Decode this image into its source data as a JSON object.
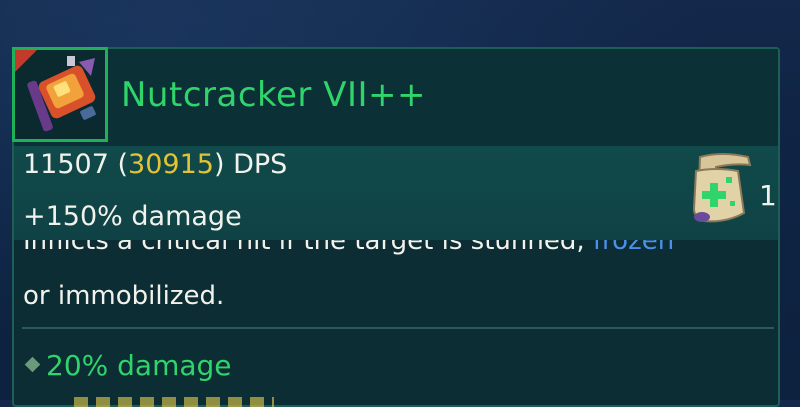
{
  "item": {
    "name": "Nutcracker VII++",
    "icon": "nutcracker-weapon-icon",
    "name_color": "#2fd46a",
    "rarity_border_color": "#1fb05a"
  },
  "stats": {
    "dps_base": "11507",
    "dps_crit": "30915",
    "dps_unit": "DPS",
    "bonus": "+150% damage",
    "crit_color": "#e3c233"
  },
  "scroll": {
    "icon": "upgrade-scroll-icon",
    "count": "1"
  },
  "description": {
    "line1_prefix": "Inflicts a critical hit if the target is stunned, ",
    "line1_keyword": "frozen",
    "line2": "or immobilized.",
    "keyword_color": "#4a8fe8"
  },
  "affixes": [
    {
      "text": "20% damage",
      "bullet_icon": "diamond-bullet-icon"
    }
  ]
}
